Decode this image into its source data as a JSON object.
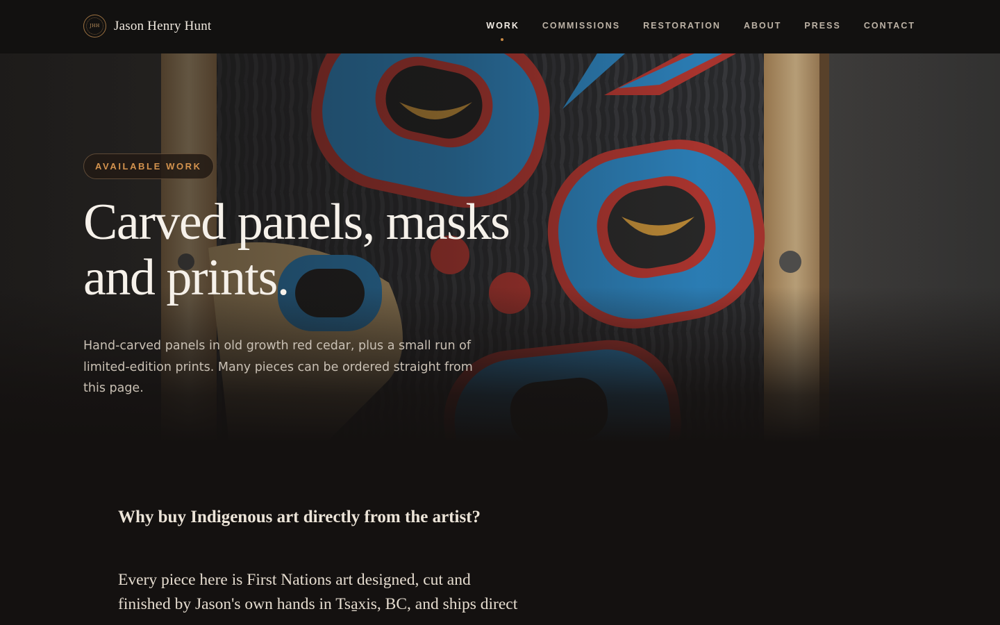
{
  "brand": {
    "monogram": "JHH",
    "name": "Jason Henry Hunt"
  },
  "nav": [
    {
      "label": "WORK",
      "active": true
    },
    {
      "label": "COMMISSIONS",
      "active": false
    },
    {
      "label": "RESTORATION",
      "active": false
    },
    {
      "label": "ABOUT",
      "active": false
    },
    {
      "label": "PRESS",
      "active": false
    },
    {
      "label": "CONTACT",
      "active": false
    }
  ],
  "hero": {
    "badge": "AVAILABLE WORK",
    "headline_line1": "Carved panels, masks",
    "headline_line2": "and prints.",
    "lede": "Hand-carved panels in old growth red cedar, plus a small run of limited-edition prints. Many pieces can be ordered straight from this page.",
    "image_subject": "carved-formline-panel"
  },
  "content": {
    "question": "Why buy Indigenous art directly from the artist?",
    "paragraph": "Every piece here is First Nations art designed, cut and finished by Jason's own hands in Tsa̱xis, BC, and ships direct"
  },
  "colors": {
    "accent": "#c98a45",
    "background": "#141110",
    "panel_blue": "#2f8fd0",
    "panel_red": "#c23a33"
  }
}
